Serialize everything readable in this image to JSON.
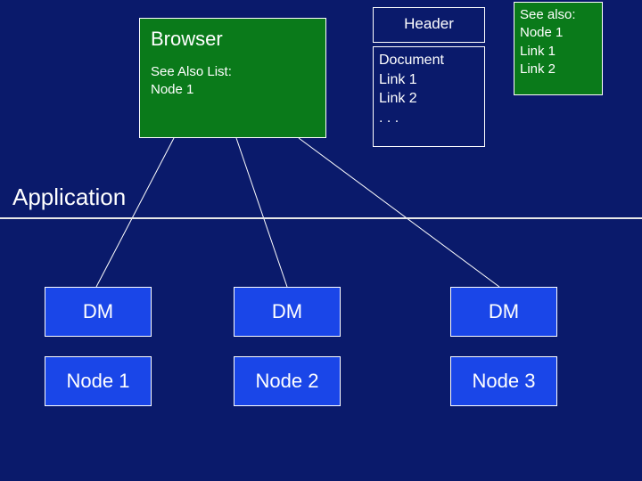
{
  "browser": {
    "title": "Browser",
    "sub1": "See Also List:",
    "sub2": "Node 1"
  },
  "header": {
    "label": "Header"
  },
  "doc": {
    "title": "Document",
    "l1": "Link 1",
    "l2": "Link 2",
    "dots": ". . ."
  },
  "seealso": {
    "title": "See also:",
    "n": "Node 1",
    "l1": "Link 1",
    "l2": "Link 2"
  },
  "app": {
    "label": "Application"
  },
  "dm": {
    "label": "DM",
    "n1": "Node 1",
    "n2": "Node 2",
    "n3": "Node 3"
  }
}
